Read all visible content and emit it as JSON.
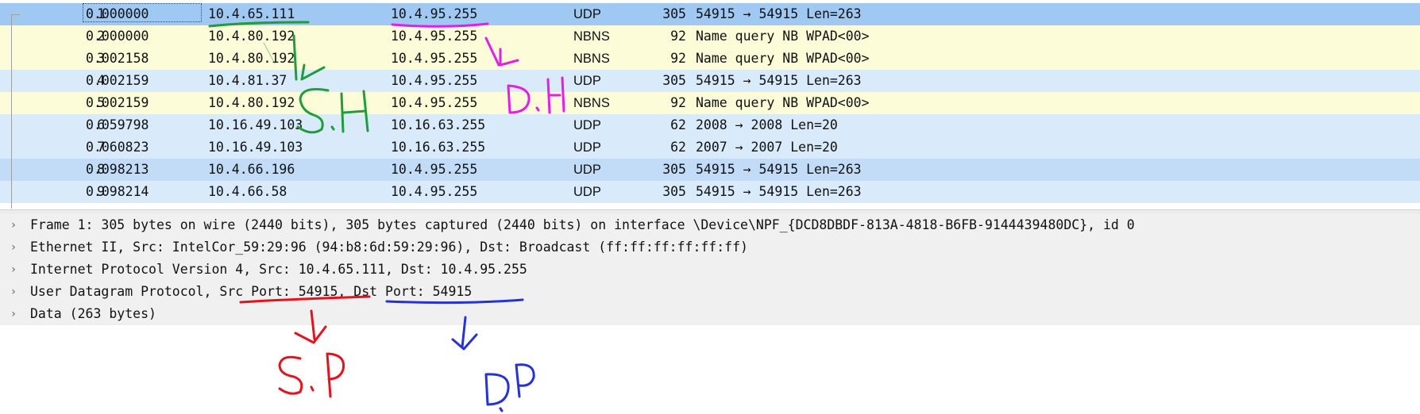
{
  "packet_list": {
    "rows": [
      {
        "no": "1",
        "time": "0.000000",
        "src": "10.4.65.111",
        "dst": "10.4.95.255",
        "proto": "UDP",
        "len": "305",
        "info": "54915 → 54915 Len=263",
        "bg": "#9fc8f2"
      },
      {
        "no": "2",
        "time": "0.000000",
        "src": "10.4.80.192",
        "dst": "10.4.95.255",
        "proto": "NBNS",
        "len": "92",
        "info": "Name query NB WPAD<00>",
        "bg": "#fcfcd8"
      },
      {
        "no": "3",
        "time": "0.002158",
        "src": "10.4.80.192",
        "dst": "10.4.95.255",
        "proto": "NBNS",
        "len": "92",
        "info": "Name query NB WPAD<00>",
        "bg": "#fcfcd8"
      },
      {
        "no": "4",
        "time": "0.002159",
        "src": "10.4.81.37",
        "dst": "10.4.95.255",
        "proto": "UDP",
        "len": "305",
        "info": "54915 → 54915 Len=263",
        "bg": "#d9eafb"
      },
      {
        "no": "5",
        "time": "0.002159",
        "src": "10.4.80.192",
        "dst": "10.4.95.255",
        "proto": "NBNS",
        "len": "92",
        "info": "Name query NB WPAD<00>",
        "bg": "#fcfcd8"
      },
      {
        "no": "6",
        "time": "0.059798",
        "src": "10.16.49.103",
        "dst": "10.16.63.255",
        "proto": "UDP",
        "len": "62",
        "info": "2008 → 2008 Len=20",
        "bg": "#d9eafb"
      },
      {
        "no": "7",
        "time": "0.060823",
        "src": "10.16.49.103",
        "dst": "10.16.63.255",
        "proto": "UDP",
        "len": "62",
        "info": "2007 → 2007 Len=20",
        "bg": "#d9eafb"
      },
      {
        "no": "8",
        "time": "0.098213",
        "src": "10.4.66.196",
        "dst": "10.4.95.255",
        "proto": "UDP",
        "len": "305",
        "info": "54915 → 54915 Len=263",
        "bg": "#c2dcf7"
      },
      {
        "no": "9",
        "time": "0.098214",
        "src": "10.4.66.58",
        "dst": "10.4.95.255",
        "proto": "UDP",
        "len": "305",
        "info": "54915 → 54915 Len=263",
        "bg": "#d9eafb"
      }
    ]
  },
  "details": {
    "rows": [
      {
        "text": "Frame 1: 305 bytes on wire (2440 bits), 305 bytes captured (2440 bits) on interface \\Device\\NPF_{DCD8DBDF-813A-4818-B6FB-9144439480DC}, id 0"
      },
      {
        "text": "Ethernet II, Src: IntelCor_59:29:96 (94:b8:6d:59:29:96), Dst: Broadcast (ff:ff:ff:ff:ff:ff)"
      },
      {
        "text": "Internet Protocol Version 4, Src: 10.4.65.111, Dst: 10.4.95.255"
      },
      {
        "text": "User Datagram Protocol, Src Port: 54915, Dst Port: 54915"
      },
      {
        "text": "Data (263 bytes)"
      }
    ],
    "expand_icon": "chevron-right-icon"
  },
  "annotations": {
    "source_host": "S.H",
    "dest_host": "D.H",
    "source_port": "S.P",
    "dest_port": "D.P",
    "colors": {
      "green": "#1e9e3a",
      "magenta": "#e81ce8",
      "red": "#e8101a",
      "blue": "#2432d8"
    }
  }
}
